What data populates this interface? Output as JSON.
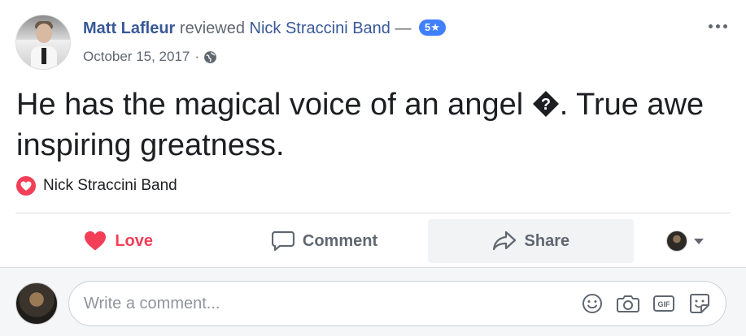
{
  "post": {
    "author": "Matt Lafleur",
    "verb": "reviewed",
    "page_name": "Nick Straccini Band",
    "dash": "—",
    "rating_badge": "5★",
    "date": "October 15, 2017",
    "date_separator": "·",
    "privacy_icon": "globe-icon",
    "text_part1": "He has the magical voice of an angel ",
    "text_part2": ". True awe inspiring greatness.",
    "recommended_page": "Nick Straccini Band"
  },
  "actions": {
    "love_label": "Love",
    "comment_label": "Comment",
    "share_label": "Share"
  },
  "comment_box": {
    "placeholder": "Write a comment..."
  },
  "colors": {
    "link": "#385898",
    "love": "#f33e58",
    "badge": "#4080ff",
    "muted": "#606770"
  }
}
